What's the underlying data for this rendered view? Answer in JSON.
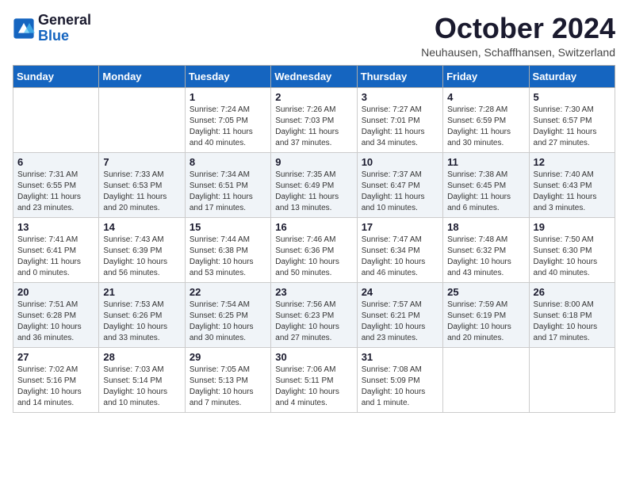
{
  "header": {
    "logo_line1": "General",
    "logo_line2": "Blue",
    "month_title": "October 2024",
    "subtitle": "Neuhausen, Schaffhansen, Switzerland"
  },
  "weekdays": [
    "Sunday",
    "Monday",
    "Tuesday",
    "Wednesday",
    "Thursday",
    "Friday",
    "Saturday"
  ],
  "weeks": [
    [
      {
        "day": "",
        "info": ""
      },
      {
        "day": "",
        "info": ""
      },
      {
        "day": "1",
        "info": "Sunrise: 7:24 AM\nSunset: 7:05 PM\nDaylight: 11 hours and 40 minutes."
      },
      {
        "day": "2",
        "info": "Sunrise: 7:26 AM\nSunset: 7:03 PM\nDaylight: 11 hours and 37 minutes."
      },
      {
        "day": "3",
        "info": "Sunrise: 7:27 AM\nSunset: 7:01 PM\nDaylight: 11 hours and 34 minutes."
      },
      {
        "day": "4",
        "info": "Sunrise: 7:28 AM\nSunset: 6:59 PM\nDaylight: 11 hours and 30 minutes."
      },
      {
        "day": "5",
        "info": "Sunrise: 7:30 AM\nSunset: 6:57 PM\nDaylight: 11 hours and 27 minutes."
      }
    ],
    [
      {
        "day": "6",
        "info": "Sunrise: 7:31 AM\nSunset: 6:55 PM\nDaylight: 11 hours and 23 minutes."
      },
      {
        "day": "7",
        "info": "Sunrise: 7:33 AM\nSunset: 6:53 PM\nDaylight: 11 hours and 20 minutes."
      },
      {
        "day": "8",
        "info": "Sunrise: 7:34 AM\nSunset: 6:51 PM\nDaylight: 11 hours and 17 minutes."
      },
      {
        "day": "9",
        "info": "Sunrise: 7:35 AM\nSunset: 6:49 PM\nDaylight: 11 hours and 13 minutes."
      },
      {
        "day": "10",
        "info": "Sunrise: 7:37 AM\nSunset: 6:47 PM\nDaylight: 11 hours and 10 minutes."
      },
      {
        "day": "11",
        "info": "Sunrise: 7:38 AM\nSunset: 6:45 PM\nDaylight: 11 hours and 6 minutes."
      },
      {
        "day": "12",
        "info": "Sunrise: 7:40 AM\nSunset: 6:43 PM\nDaylight: 11 hours and 3 minutes."
      }
    ],
    [
      {
        "day": "13",
        "info": "Sunrise: 7:41 AM\nSunset: 6:41 PM\nDaylight: 11 hours and 0 minutes."
      },
      {
        "day": "14",
        "info": "Sunrise: 7:43 AM\nSunset: 6:39 PM\nDaylight: 10 hours and 56 minutes."
      },
      {
        "day": "15",
        "info": "Sunrise: 7:44 AM\nSunset: 6:38 PM\nDaylight: 10 hours and 53 minutes."
      },
      {
        "day": "16",
        "info": "Sunrise: 7:46 AM\nSunset: 6:36 PM\nDaylight: 10 hours and 50 minutes."
      },
      {
        "day": "17",
        "info": "Sunrise: 7:47 AM\nSunset: 6:34 PM\nDaylight: 10 hours and 46 minutes."
      },
      {
        "day": "18",
        "info": "Sunrise: 7:48 AM\nSunset: 6:32 PM\nDaylight: 10 hours and 43 minutes."
      },
      {
        "day": "19",
        "info": "Sunrise: 7:50 AM\nSunset: 6:30 PM\nDaylight: 10 hours and 40 minutes."
      }
    ],
    [
      {
        "day": "20",
        "info": "Sunrise: 7:51 AM\nSunset: 6:28 PM\nDaylight: 10 hours and 36 minutes."
      },
      {
        "day": "21",
        "info": "Sunrise: 7:53 AM\nSunset: 6:26 PM\nDaylight: 10 hours and 33 minutes."
      },
      {
        "day": "22",
        "info": "Sunrise: 7:54 AM\nSunset: 6:25 PM\nDaylight: 10 hours and 30 minutes."
      },
      {
        "day": "23",
        "info": "Sunrise: 7:56 AM\nSunset: 6:23 PM\nDaylight: 10 hours and 27 minutes."
      },
      {
        "day": "24",
        "info": "Sunrise: 7:57 AM\nSunset: 6:21 PM\nDaylight: 10 hours and 23 minutes."
      },
      {
        "day": "25",
        "info": "Sunrise: 7:59 AM\nSunset: 6:19 PM\nDaylight: 10 hours and 20 minutes."
      },
      {
        "day": "26",
        "info": "Sunrise: 8:00 AM\nSunset: 6:18 PM\nDaylight: 10 hours and 17 minutes."
      }
    ],
    [
      {
        "day": "27",
        "info": "Sunrise: 7:02 AM\nSunset: 5:16 PM\nDaylight: 10 hours and 14 minutes."
      },
      {
        "day": "28",
        "info": "Sunrise: 7:03 AM\nSunset: 5:14 PM\nDaylight: 10 hours and 10 minutes."
      },
      {
        "day": "29",
        "info": "Sunrise: 7:05 AM\nSunset: 5:13 PM\nDaylight: 10 hours and 7 minutes."
      },
      {
        "day": "30",
        "info": "Sunrise: 7:06 AM\nSunset: 5:11 PM\nDaylight: 10 hours and 4 minutes."
      },
      {
        "day": "31",
        "info": "Sunrise: 7:08 AM\nSunset: 5:09 PM\nDaylight: 10 hours and 1 minute."
      },
      {
        "day": "",
        "info": ""
      },
      {
        "day": "",
        "info": ""
      }
    ]
  ]
}
